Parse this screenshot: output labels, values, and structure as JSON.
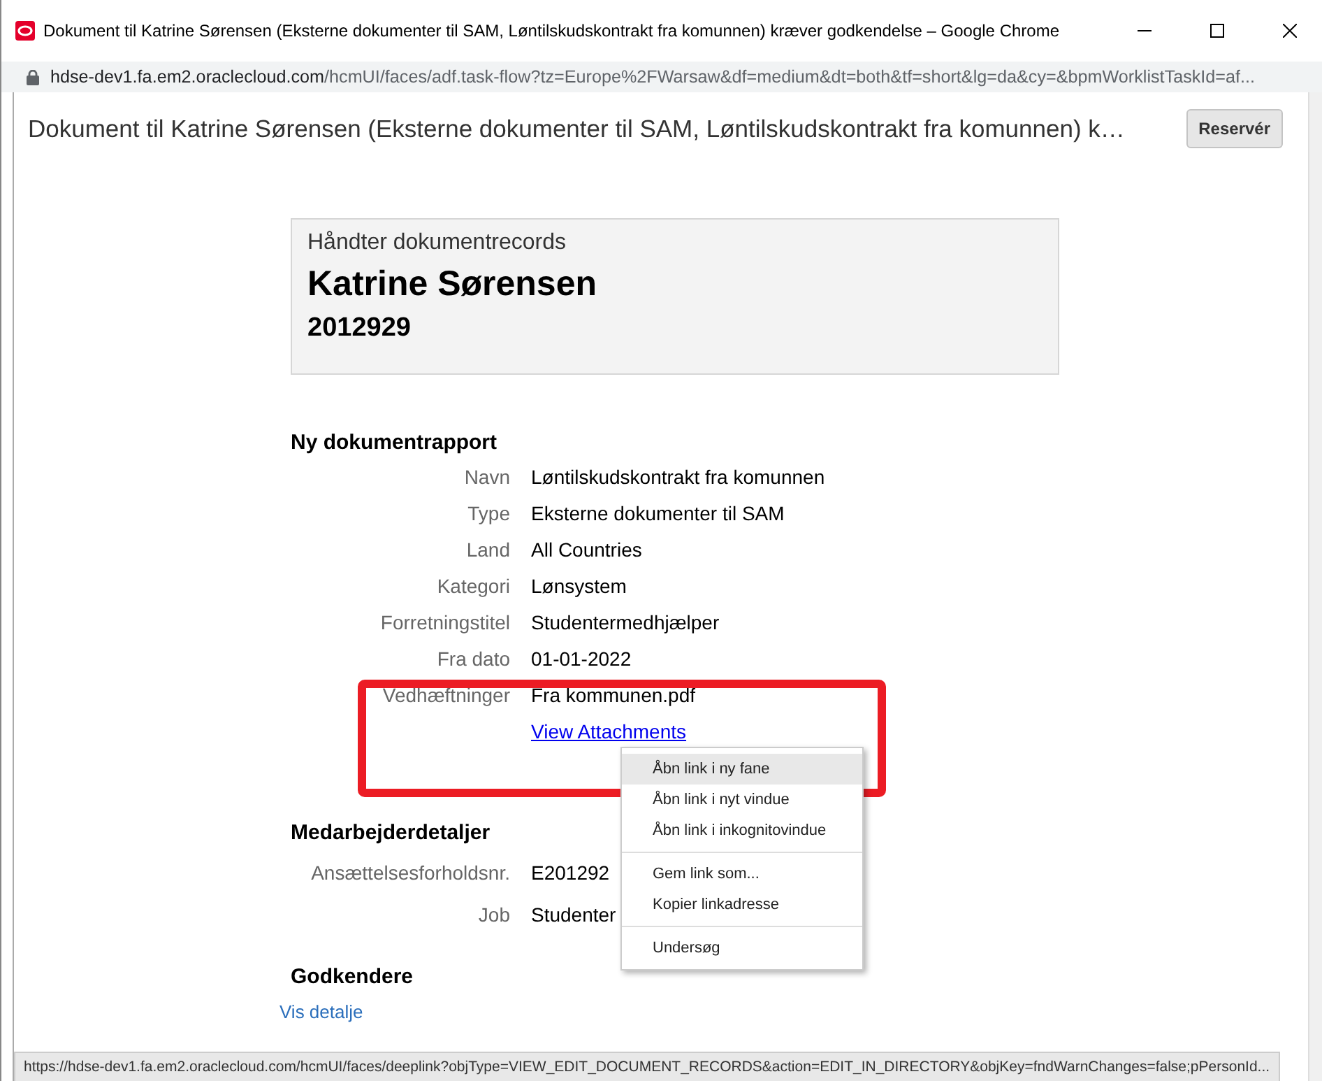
{
  "window": {
    "title": "Dokument til Katrine Sørensen (Eksterne dokumenter til SAM, Løntilskudskontrakt fra komunnen) kræver godkendelse – Google Chrome"
  },
  "address_bar": {
    "host": "hdse-dev1.fa.em2.oraclecloud.com",
    "path": "/hcmUI/faces/adf.task-flow?tz=Europe%2FWarsaw&df=medium&dt=both&tf=short&lg=da&cy=&bpmWorklistTaskId=af..."
  },
  "page": {
    "title": "Dokument til Katrine Sørensen (Eksterne dokumenter til SAM, Løntilskudskontrakt fra komunnen) k…",
    "reserve_button": "Reservér"
  },
  "header_card": {
    "subtitle": "Håndter dokumentrecords",
    "name": "Katrine Sørensen",
    "number": "2012929"
  },
  "report": {
    "heading": "Ny dokumentrapport",
    "fields": [
      {
        "label": "Navn",
        "value": "Løntilskudskontrakt fra komunnen"
      },
      {
        "label": "Type",
        "value": "Eksterne dokumenter til SAM"
      },
      {
        "label": "Land",
        "value": "All Countries"
      },
      {
        "label": "Kategori",
        "value": "Lønsystem"
      },
      {
        "label": "Forretningstitel",
        "value": "Studentermedhjælper"
      },
      {
        "label": "Fra dato",
        "value": "01-01-2022"
      },
      {
        "label": "Vedhæftninger",
        "value": "Fra kommunen.pdf"
      }
    ],
    "attachments_link": "View Attachments"
  },
  "employee": {
    "heading": "Medarbejderdetaljer",
    "fields": [
      {
        "label": "Ansættelsesforholdsnr.",
        "value": "E201292"
      },
      {
        "label": "Job",
        "value": "Studenter"
      }
    ]
  },
  "approvers": {
    "heading": "Godkendere",
    "link": "Vis detalje"
  },
  "context_menu": [
    {
      "label": "Åbn link i ny fane",
      "selected": true,
      "separator_before": false
    },
    {
      "label": "Åbn link i nyt vindue",
      "selected": false,
      "separator_before": false
    },
    {
      "label": "Åbn link i inkognitovindue",
      "selected": false,
      "separator_before": false
    },
    {
      "label": "Gem link som...",
      "selected": false,
      "separator_before": true
    },
    {
      "label": "Kopier linkadresse",
      "selected": false,
      "separator_before": false
    },
    {
      "label": "Undersøg",
      "selected": false,
      "separator_before": true
    }
  ],
  "status_bar": {
    "url": "https://hdse-dev1.fa.em2.oraclecloud.com/hcmUI/faces/deeplink?objType=VIEW_EDIT_DOCUMENT_RECORDS&action=EDIT_IN_DIRECTORY&objKey=fndWarnChanges=false;pPersonId..."
  }
}
